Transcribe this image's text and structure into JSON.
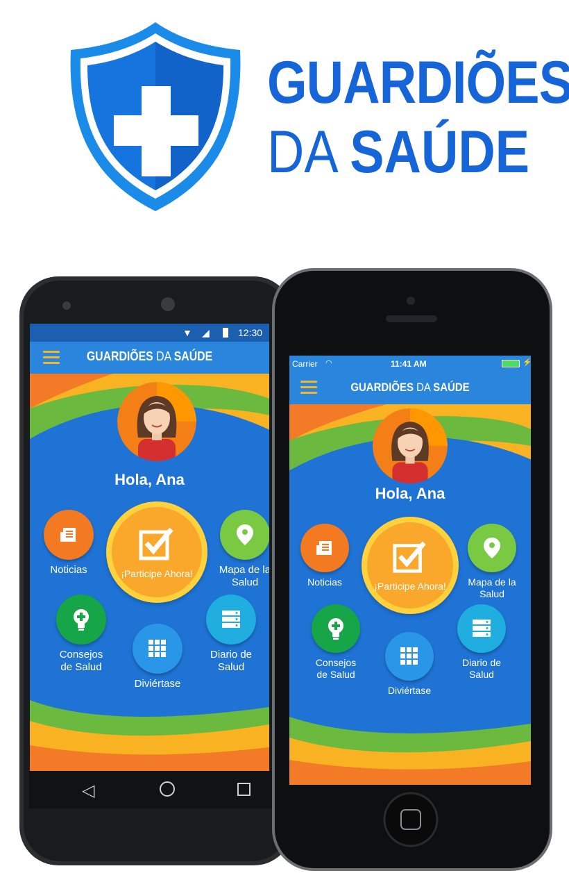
{
  "logo": {
    "line1": "GUARDIÕES",
    "line2_a": "DA",
    "line2_b": "SAÚDE",
    "icon": "shield-cross-icon",
    "color": "#1565d8"
  },
  "app": {
    "title_a": "GUARDIÕES",
    "title_b": "DA",
    "title_c": "SAÚDE",
    "greeting": "Hola, Ana",
    "cta_label": "¡Participe Ahora!",
    "items": {
      "news": "Noticias",
      "map_1": "Mapa de la",
      "map_2": "Salud",
      "tips_1": "Consejos",
      "tips_2": "de Salud",
      "fun": "Diviértase",
      "diary_1": "Diario de",
      "diary_2": "Salud"
    }
  },
  "android": {
    "status_time": "12:30"
  },
  "ios": {
    "carrier": "Carrier",
    "time": "11:41 AM"
  },
  "colors": {
    "appbar": "#2a86dc",
    "background_blue": "#1f73d4",
    "orange": "#f37a26",
    "yellow": "#f9b322",
    "green": "#6cb93f",
    "news": "#f47a21",
    "map": "#7ac943",
    "tips": "#16a547",
    "diary": "#20aee0",
    "fun": "#2996e8"
  }
}
